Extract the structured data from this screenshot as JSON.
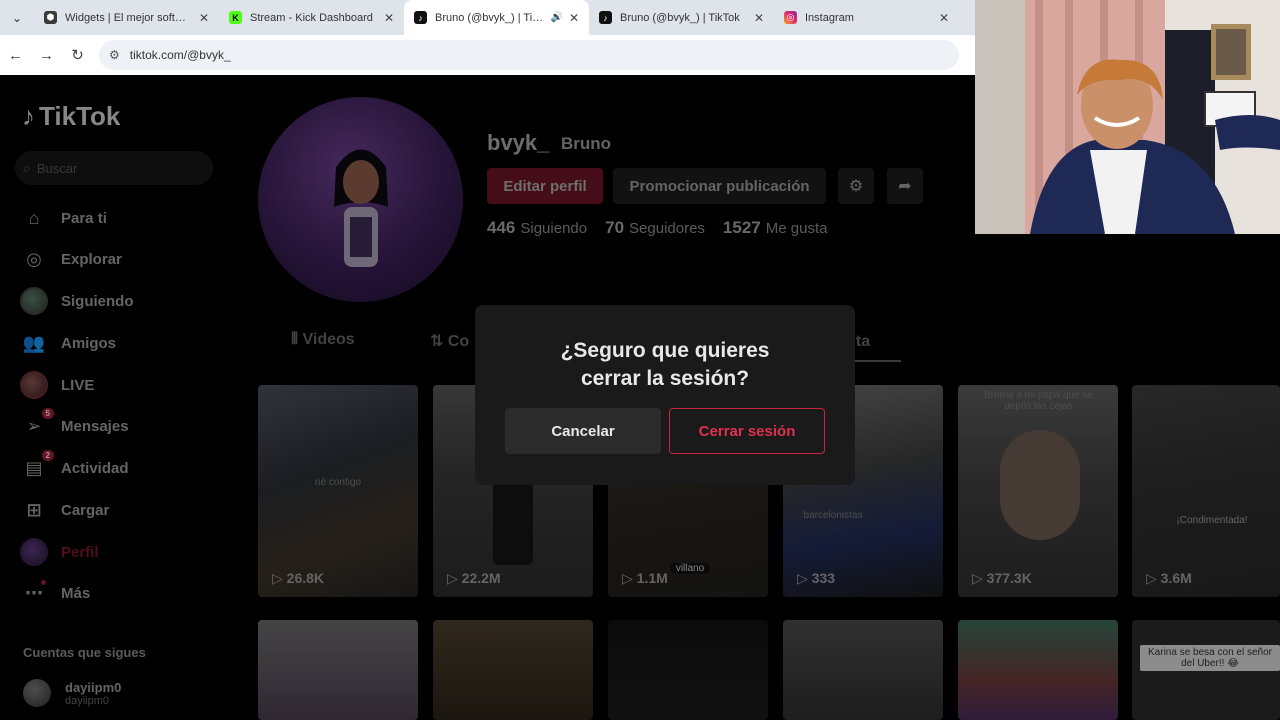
{
  "browser": {
    "tabs": [
      {
        "title": "Widgets | El mejor software",
        "favicon_color": "#3a3a3a",
        "active": false
      },
      {
        "title": "Stream - Kick Dashboard",
        "favicon_color": "#53fc18",
        "active": false
      },
      {
        "title": "Bruno (@bvyk_) | TikTok",
        "favicon_color": "#111111",
        "active": true
      },
      {
        "title": "Bruno (@bvyk_) | TikTok",
        "favicon_color": "#111111",
        "active": false
      },
      {
        "title": "Instagram",
        "favicon_color": "#e1306c",
        "active": false
      }
    ],
    "url": "tiktok.com/@bvyk_"
  },
  "sidebar": {
    "logo": "TikTok",
    "search_placeholder": "Buscar",
    "items": [
      {
        "label": "Para ti",
        "icon": "home-icon"
      },
      {
        "label": "Explorar",
        "icon": "compass-icon"
      },
      {
        "label": "Siguiendo",
        "icon": "avatar-icon"
      },
      {
        "label": "Amigos",
        "icon": "friends-icon"
      },
      {
        "label": "LIVE",
        "icon": "live-avatar-icon"
      },
      {
        "label": "Mensajes",
        "icon": "send-icon",
        "badge": "5"
      },
      {
        "label": "Actividad",
        "icon": "inbox-icon",
        "badge": "2"
      },
      {
        "label": "Cargar",
        "icon": "upload-icon"
      },
      {
        "label": "Perfil",
        "icon": "profile-avatar-icon"
      },
      {
        "label": "Más",
        "icon": "more-icon"
      }
    ],
    "following_title": "Cuentas que sigues",
    "following_accounts": [
      {
        "name": "dayiipm0",
        "handle": "dayiipm0"
      }
    ]
  },
  "profile": {
    "username": "bvyk_",
    "display_name": "Bruno",
    "edit_button": "Editar perfil",
    "promote_button": "Promocionar publicación",
    "stats": {
      "following_count": "446",
      "following_label": "Siguiendo",
      "followers_count": "70",
      "followers_label": "Seguidores",
      "likes_count": "1527",
      "likes_label": "Me gusta"
    },
    "tabs": [
      "Videos",
      "Co",
      "Me gusta"
    ],
    "videos": [
      {
        "views": "26.8K",
        "caption": "né contigo"
      },
      {
        "views": "22.2M",
        "caption": ""
      },
      {
        "views": "1.1M",
        "caption": "villano"
      },
      {
        "views": "333",
        "caption": "barcelonistas"
      },
      {
        "views": "377.3K",
        "caption": "Broma a mi papá que se depiló las cejas"
      },
      {
        "views": "3.6M",
        "caption": "¡Condimentada!"
      }
    ],
    "bottom_caption": "Karina se besa con el señor del Uber!! 😂"
  },
  "modal": {
    "title_line1": "¿Seguro que quieres",
    "title_line2": "cerrar la sesión?",
    "cancel": "Cancelar",
    "confirm": "Cerrar sesión"
  },
  "colors": {
    "tiktok_red": "#fe2c55",
    "modal_bg": "#1a1a1a"
  }
}
